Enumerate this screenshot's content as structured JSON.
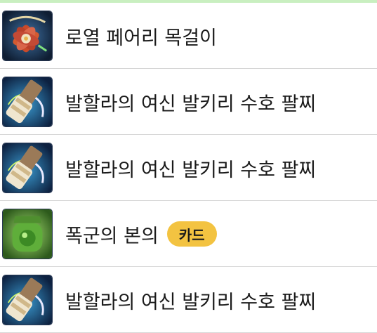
{
  "items": [
    {
      "name": "로열 페어리 목걸이",
      "icon": "necklace-icon"
    },
    {
      "name": "발할라의 여신 발키리 수호 팔찌",
      "icon": "bracelet-icon"
    },
    {
      "name": "발할라의 여신 발키리 수호 팔찌",
      "icon": "bracelet-icon"
    },
    {
      "name": "폭군의 본의",
      "icon": "green-orb-icon",
      "badge": "카드"
    },
    {
      "name": "발할라의 여신 발키리 수호 팔찌",
      "icon": "bracelet-icon"
    }
  ],
  "colors": {
    "accent_line": "#c9efc0",
    "badge_bg": "#f3c341",
    "divider": "#d6d6d6"
  }
}
